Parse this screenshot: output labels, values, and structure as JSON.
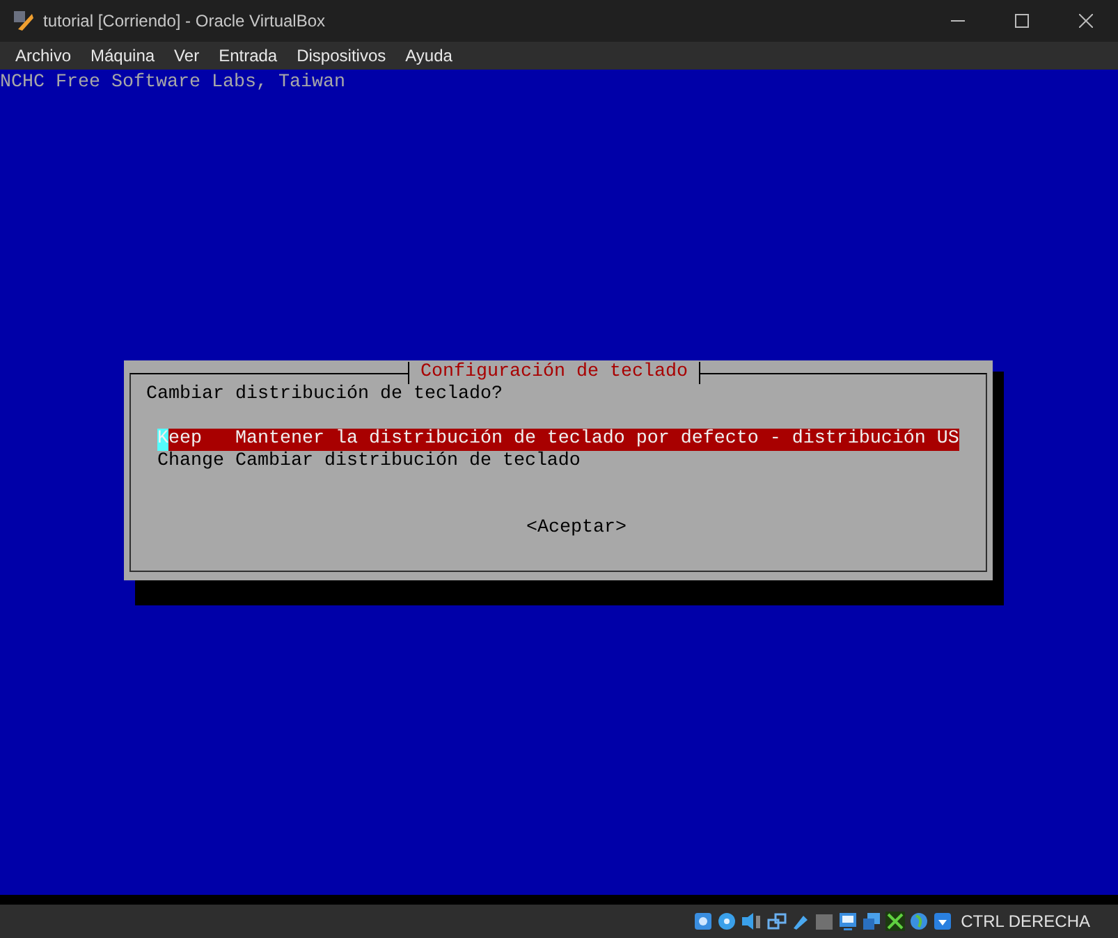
{
  "window": {
    "title": "tutorial [Corriendo] - Oracle VirtualBox"
  },
  "menu": [
    "Archivo",
    "Máquina",
    "Ver",
    "Entrada",
    "Dispositivos",
    "Ayuda"
  ],
  "console": {
    "banner": "NCHC Free Software Labs, Taiwan",
    "dialog": {
      "title": "Configuración de teclado",
      "question": "Cambiar distribución de teclado?",
      "options": [
        {
          "key": "Keep",
          "description": "Mantener la distribución de teclado por defecto - distribución US",
          "selected": true
        },
        {
          "key": "Change",
          "description": "Cambiar distribución de teclado",
          "selected": false
        }
      ],
      "button": "<Aceptar>"
    }
  },
  "status_bar": {
    "host_key": "CTRL DERECHA"
  }
}
